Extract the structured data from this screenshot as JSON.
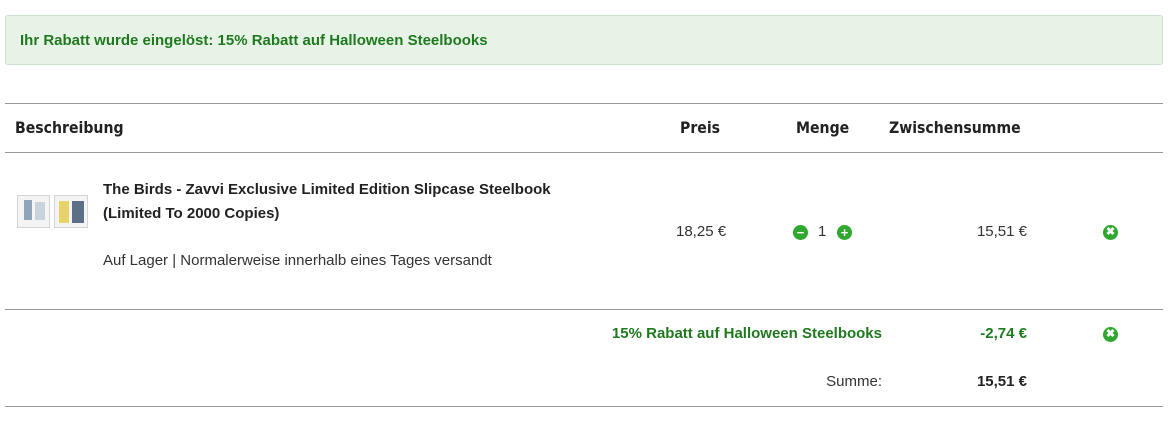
{
  "alert": {
    "text": "Ihr Rabatt wurde eingelöst: 15% Rabatt auf Halloween Steelbooks"
  },
  "table": {
    "headers": {
      "description": "Beschreibung",
      "price": "Preis",
      "quantity": "Menge",
      "subtotal": "Zwischensumme"
    },
    "items": [
      {
        "title": "The Birds - Zavvi Exclusive Limited Edition Slipcase Steelbook (Limited To 2000 Copies)",
        "availability": "Auf Lager | Normalerweise innerhalb eines Tages versandt",
        "price": "18,25 €",
        "quantity": "1",
        "subtotal": "15,51 €"
      }
    ]
  },
  "discount": {
    "label": "15% Rabatt auf Halloween Steelbooks",
    "value": "-2,74 €"
  },
  "total": {
    "label": "Summe:",
    "value": "15,51 €"
  },
  "icons": {
    "minus": "−",
    "plus": "+",
    "remove": "✖"
  },
  "colors": {
    "accent_green": "#2ea82e",
    "alert_background": "#e8f3e8",
    "discount_text": "#1f7a1f"
  }
}
